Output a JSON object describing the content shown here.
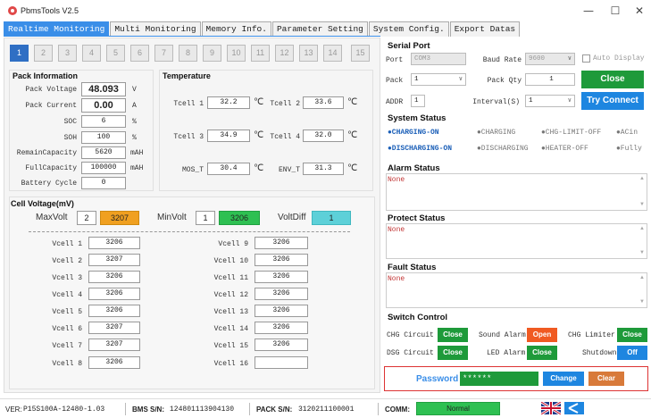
{
  "window": {
    "title": "PbmsTools V2.5",
    "minimize": "—",
    "maximize": "☐",
    "close": "✕"
  },
  "menu": [
    "Realtime Monitoring",
    "Multi Monitoring",
    "Memory Info.",
    "Parameter Setting",
    "System Config.",
    "Export Datas"
  ],
  "pack_tabs": [
    "1",
    "2",
    "3",
    "4",
    "5",
    "6",
    "7",
    "8",
    "9",
    "10",
    "11",
    "12",
    "13",
    "14",
    "15"
  ],
  "pack_info": {
    "title": "Pack Information",
    "rows": [
      {
        "label": "Pack Voltage",
        "value": "48.093",
        "unit": "V"
      },
      {
        "label": "Pack Current",
        "value": "0.00",
        "unit": "A"
      },
      {
        "label": "SOC",
        "value": "6",
        "unit": "%"
      },
      {
        "label": "SOH",
        "value": "100",
        "unit": "%"
      },
      {
        "label": "RemainCapacity",
        "value": "5620",
        "unit": "mAH"
      },
      {
        "label": "FullCapacity",
        "value": "100000",
        "unit": "mAH"
      },
      {
        "label": "Battery Cycle",
        "value": "0",
        "unit": ""
      }
    ]
  },
  "temperature": {
    "title": "Temperature",
    "rows": [
      {
        "l1": "Tcell 1",
        "v1": "32.2",
        "l2": "Tcell 2",
        "v2": "33.6"
      },
      {
        "l1": "Tcell 3",
        "v1": "34.9",
        "l2": "Tcell 4",
        "v2": "32.0"
      },
      {
        "l1": "MOS_T",
        "v1": "30.4",
        "l2": "ENV_T",
        "v2": "31.3"
      }
    ],
    "unit": "℃"
  },
  "cell_voltage": {
    "title": "Cell Voltage(mV)",
    "max_label": "MaxVolt",
    "max_idx": "2",
    "max_val": "3207",
    "min_label": "MinVolt",
    "min_idx": "1",
    "min_val": "3206",
    "diff_label": "VoltDiff",
    "diff_val": "1",
    "cells_left": [
      {
        "label": "Vcell 1",
        "value": "3206"
      },
      {
        "label": "Vcell 2",
        "value": "3207"
      },
      {
        "label": "Vcell 3",
        "value": "3206"
      },
      {
        "label": "Vcell 4",
        "value": "3206"
      },
      {
        "label": "Vcell 5",
        "value": "3206"
      },
      {
        "label": "Vcell 6",
        "value": "3207"
      },
      {
        "label": "Vcell 7",
        "value": "3207"
      },
      {
        "label": "Vcell 8",
        "value": "3206"
      }
    ],
    "cells_right": [
      {
        "label": "Vcell 9",
        "value": "3206"
      },
      {
        "label": "Vcell 10",
        "value": "3206"
      },
      {
        "label": "Vcell 11",
        "value": "3206"
      },
      {
        "label": "Vcell 12",
        "value": "3206"
      },
      {
        "label": "Vcell 13",
        "value": "3206"
      },
      {
        "label": "Vcell 14",
        "value": "3206"
      },
      {
        "label": "Vcell 15",
        "value": "3206"
      },
      {
        "label": "Vcell 16",
        "value": ""
      }
    ]
  },
  "serial_port": {
    "title": "Serial Port",
    "port_label": "Port",
    "port_value": "COM3",
    "baud_label": "Baud Rate",
    "baud_value": "9600",
    "auto_display": "Auto Display",
    "pack_label": "Pack",
    "pack_value": "1",
    "pack_qty_label": "Pack Qty",
    "pack_qty_value": "1",
    "close_button": "Close",
    "addr_label": "ADDR",
    "addr_value": "1",
    "interval_label": "Interval(S)",
    "interval_value": "1",
    "try_connect": "Try Connect"
  },
  "system_status": {
    "title": "System Status",
    "row1": [
      {
        "text": "●CHARGING-ON",
        "on": true
      },
      {
        "text": "●CHARGING",
        "on": false
      },
      {
        "text": "●CHG-LIMIT-OFF",
        "on": false
      },
      {
        "text": "●ACin",
        "on": false
      }
    ],
    "row2": [
      {
        "text": "●DISCHARGING-ON",
        "on": true
      },
      {
        "text": "●DISCHARGING",
        "on": false
      },
      {
        "text": "●HEATER-OFF",
        "on": false
      },
      {
        "text": "●Fully",
        "on": false
      }
    ]
  },
  "alarm_status": {
    "title": "Alarm Status",
    "value": "None"
  },
  "protect_status": {
    "title": "Protect Status",
    "value": "None"
  },
  "fault_status": {
    "title": "Fault Status",
    "value": "None"
  },
  "switch_control": {
    "title": "Switch Control",
    "chg_circuit": "CHG Circuit",
    "chg_btn": "Close",
    "sound_alarm": "Sound Alarm",
    "sound_btn": "Open",
    "chg_limiter": "CHG Limiter",
    "chg_limiter_btn": "Close",
    "dsg_circuit": "DSG Circuit",
    "dsg_btn": "Close",
    "led_alarm": "LED Alarm",
    "led_btn": "Close",
    "shutdown": "Shutdown",
    "shutdown_btn": "Off"
  },
  "password": {
    "label": "Password",
    "value": "******",
    "change": "Change",
    "clear": "Clear"
  },
  "footer": {
    "ver_label": "VER:",
    "ver_value": "P15S100A-12480-1.03",
    "bms_label": "BMS S/N:",
    "bms_value": "124801113904130",
    "pack_label": "PACK S/N:",
    "pack_value": "3120211100001",
    "comm_label": "COMM:",
    "comm_value": "Normal"
  },
  "colors": {
    "accent": "#3a8ee8",
    "green": "#1e9a3a",
    "orange": "#f05a22",
    "max_volt": "#f0a020",
    "min_volt": "#2ec052",
    "diff": "#5dd0d8"
  }
}
